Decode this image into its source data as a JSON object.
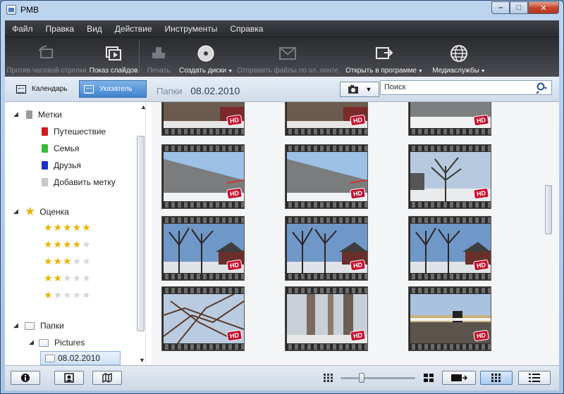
{
  "window": {
    "title": "PMB"
  },
  "menu": [
    "Файл",
    "Правка",
    "Вид",
    "Действие",
    "Инструменты",
    "Справка"
  ],
  "toolbar": {
    "rotate_label": "Против часовой стрелки",
    "slideshow_label": "Показ слайдов",
    "print_label": "Печать",
    "burn_label": "Создать диски",
    "email_label": "Отправить файлы по эл. почте",
    "open_label": "Открыть в программе",
    "media_label": "Медиаслужбы"
  },
  "nav": {
    "calendar_label": "Календарь",
    "index_label": "Указатель",
    "breadcrumb_root": "Папки",
    "breadcrumb_current": "08.02.2010",
    "search_placeholder": "Поиск"
  },
  "sidebar": {
    "tags_header": "Метки",
    "tags": [
      {
        "label": "Путешествие",
        "color": "#d21a1a"
      },
      {
        "label": "Семья",
        "color": "#3ab83a"
      },
      {
        "label": "Друзья",
        "color": "#1d2fc8"
      }
    ],
    "add_tag_label": "Добавить метку",
    "rating_header": "Оценка",
    "ratings": [
      5,
      4,
      3,
      2,
      1
    ],
    "folders_header": "Папки",
    "folder_pictures": "Pictures",
    "folder_selected": "08.02.2010"
  },
  "thumbnails": {
    "badge": "HD",
    "rows": [
      [
        "house-roof",
        "house-roof",
        "wall-snow"
      ],
      [
        "wall-fence",
        "wall-fence",
        "bare-trees"
      ],
      [
        "trees-house",
        "trees-house",
        "trees-house"
      ],
      [
        "branches-sky",
        "tree-trunks",
        "fence-snow"
      ]
    ]
  },
  "colors": {
    "accent": "#3f82cf",
    "hd_badge": "#c8102e",
    "toolbar_bg": "#2f3035"
  }
}
